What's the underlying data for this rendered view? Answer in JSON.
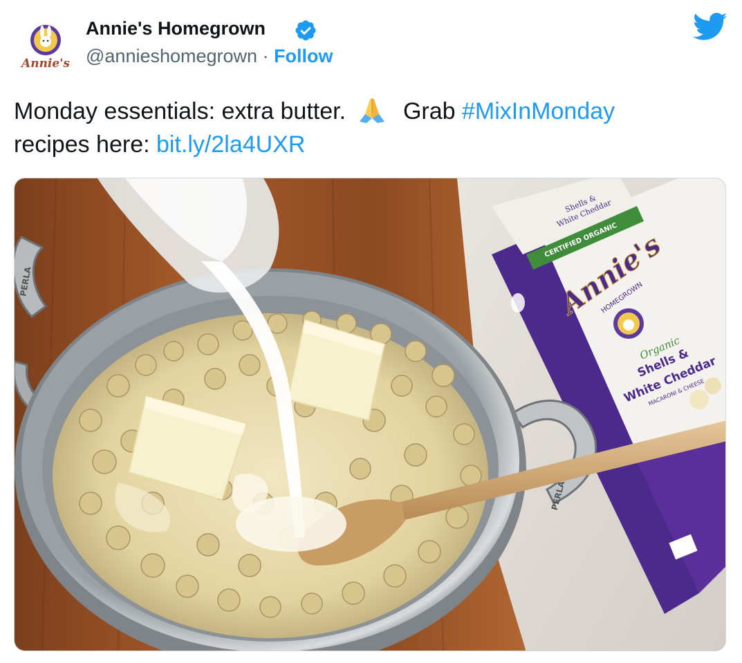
{
  "author": {
    "display_name": "Annie's Homegrown",
    "handle": "@annieshomegrown",
    "separator": " · ",
    "follow_label": "Follow",
    "verified": true,
    "avatar_text": "Annie's"
  },
  "tweet": {
    "text_part1": "Monday essentials: extra butter.",
    "emoji": "folded-hands",
    "text_part2": "Grab ",
    "hashtag": "#MixInMonday",
    "text_part3": "recipes here: ",
    "link": "bit.ly/2la4UXR"
  },
  "media": {
    "type": "photo",
    "box_brand": "Annie's",
    "box_sub": "HOMEGROWN",
    "box_line1": "Organic",
    "box_line2": "Shells &",
    "box_line3": "White Cheddar",
    "box_line4": "MACARONI & CHEESE",
    "box_top_line1": "Shells &",
    "box_top_line2": "White Cheddar",
    "box_stripe": "CERTIFIED ORGANIC",
    "pot_handle_text_left": "PERLA",
    "pot_handle_text_right": "PERLA"
  },
  "colors": {
    "twitter_blue": "#1d9bf0",
    "text": "#0f1419",
    "muted": "#536471",
    "box_purple": "#4b2a8c"
  },
  "icons": {
    "verified": "verified-badge-icon",
    "logo": "twitter-bird-icon",
    "emoji": "folded-hands-icon"
  }
}
